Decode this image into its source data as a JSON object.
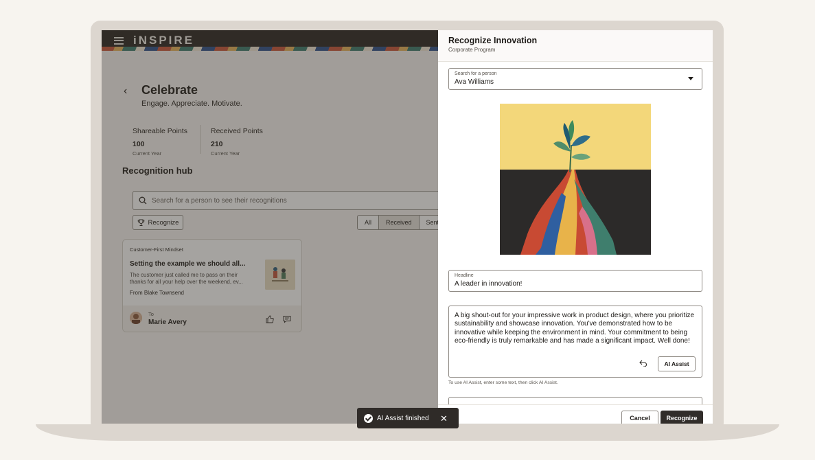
{
  "header": {
    "brand": "iNSPIRE"
  },
  "page": {
    "title": "Celebrate",
    "subtitle": "Engage. Appreciate. Motivate."
  },
  "points": [
    {
      "label": "Shareable Points",
      "value": "100",
      "sub": "Current Year"
    },
    {
      "label": "Received Points",
      "value": "210",
      "sub": "Current Year"
    }
  ],
  "hub": {
    "title": "Recognition hub",
    "search_placeholder": "Search for a person to see their recognitions",
    "recognize_label": "Recognize",
    "filters": [
      "All",
      "Received",
      "Sent"
    ],
    "active_filter": "Received"
  },
  "card": {
    "tag": "Customer-First Mindset",
    "headline": "Setting the example we should all...",
    "body": "The customer just called me to pass on their thanks for all your help over the weekend, ev...",
    "from": "From Blake Townsend",
    "to_label": "To",
    "to_name": "Marie Avery"
  },
  "drawer": {
    "title": "Recognize Innovation",
    "subtitle": "Corporate Program",
    "person_label": "Search for a person",
    "person_value": "Ava Williams",
    "headline_label": "Headline",
    "headline_value": "A leader in innovation!",
    "message": "A big shout-out for your impressive work in product design, where you prioritize sustainability and showcase innovation. You've demonstrated how to be innovative while keeping the environment in mind. Your commitment to being eco-friendly is truly remarkable and has made a significant impact. Well done!",
    "ai_assist_label": "AI Assist",
    "hint": "To use AI Assist, enter some text, then click AI Assist.",
    "cancel_label": "Cancel",
    "recognize_label": "Recognize"
  },
  "toast": {
    "message": "AI Assist finished"
  },
  "colors": {
    "primary_button": "#312d2a",
    "topbar": "#2a2621",
    "overlay": "#37322d"
  }
}
